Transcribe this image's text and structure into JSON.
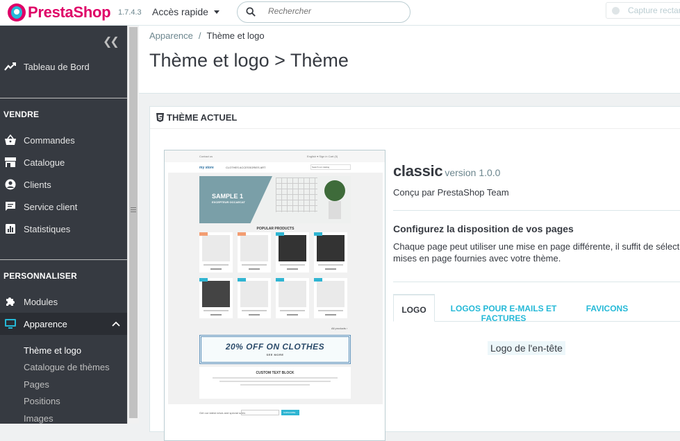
{
  "app": {
    "brand": "PrestaShop",
    "version": "1.7.4.3",
    "quick_access": "Accès rapide",
    "search_placeholder": "Rechercher",
    "capture": "Capture rectar",
    "brand_colors": {
      "pink": "#df0067",
      "blue": "#25b9d7",
      "sidebar": "#363a41"
    }
  },
  "sidebar": {
    "collapse_icon": "double-chevron-left",
    "dashboard": "Tableau de Bord",
    "sections": [
      {
        "title": "VENDRE",
        "items": [
          "Commandes",
          "Catalogue",
          "Clients",
          "Service client",
          "Statistiques"
        ]
      },
      {
        "title": "PERSONNALISER",
        "items": [
          "Modules",
          "Apparence"
        ]
      }
    ],
    "submenu": [
      "Thème et logo",
      "Catalogue de thèmes",
      "Pages",
      "Positions",
      "Images"
    ],
    "active_item": "Apparence",
    "active_sub": "Thème et logo"
  },
  "header": {
    "breadcrumb_parent": "Apparence",
    "breadcrumb_sep": "/",
    "breadcrumb_current": "Thème et logo",
    "title": "Thème et logo > Thème"
  },
  "panel": {
    "heading": "THÈME ACTUEL",
    "theme_name": "classic",
    "theme_version": "version 1.0.0",
    "author": "Conçu par PrestaShop Team",
    "config_title": "Configurez la disposition de vos pages",
    "config_desc_line1": "Chaque page peut utiliser une mise en page différente, il suffit de sélection",
    "config_desc_line2": "mises en page fournies avec votre thème.",
    "tabs": [
      "LOGO",
      "LOGOS POUR E-MAILS ET FACTURES",
      "FAVICONS"
    ],
    "active_tab": "LOGO",
    "logo_header": "Logo de l'en-tête"
  },
  "preview": {
    "top_left": "Contact us",
    "top_right": "English ▾   Sign in   Cart (0)",
    "store": "my store",
    "menu": "CLOTHES   ACCESSORIES   ART",
    "search": "Search our catalog",
    "banner_title": "SAMPLE 1",
    "banner_sub": "EXCEPTEUR OCCAECAT",
    "popular": "POPULAR PRODUCTS",
    "all_products": "All products ›",
    "offer": "20% OFF ON CLOTHES",
    "offer_sub": "SEE MORE",
    "custom": "CUSTOM TEXT BLOCK",
    "newsletter": "Get our latest news and special sales",
    "subscribe": "SUBSCRIBE"
  }
}
